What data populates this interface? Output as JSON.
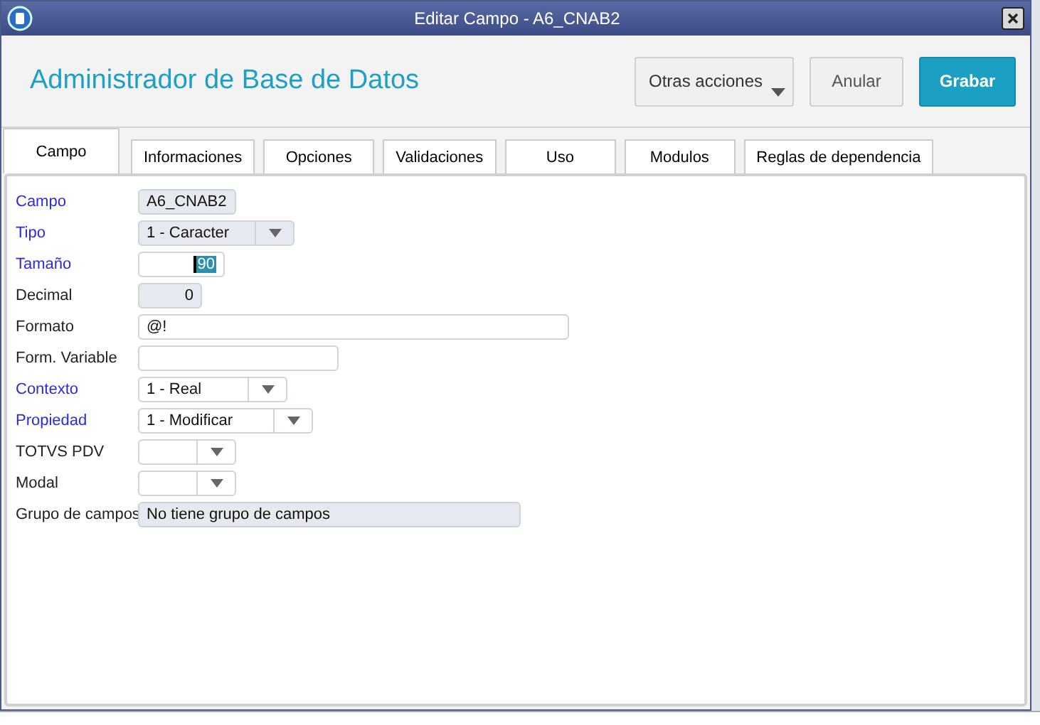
{
  "window": {
    "title": "Editar Campo - A6_CNAB2"
  },
  "header": {
    "title": "Administrador de Base de Datos",
    "buttons": [
      {
        "label": "Otras acciones",
        "kind": "menu"
      },
      {
        "label": "Anular",
        "kind": "plain"
      },
      {
        "label": "Grabar",
        "kind": "primary"
      }
    ]
  },
  "tabs": [
    {
      "label": "Campo",
      "selected": true
    },
    {
      "label": "Informaciones",
      "selected": false
    },
    {
      "label": "Opciones",
      "selected": false
    },
    {
      "label": "Validaciones",
      "selected": false
    },
    {
      "label": "Uso",
      "selected": false
    },
    {
      "label": "Modulos",
      "selected": false
    },
    {
      "label": "Reglas de dependencia",
      "selected": false
    }
  ],
  "fields": [
    {
      "label": "Campo",
      "required": true,
      "kind": "text",
      "readonly": true,
      "value": "A6_CNAB2"
    },
    {
      "label": "Tipo",
      "required": true,
      "kind": "combo",
      "readonly": true,
      "value": "1 - Caracter"
    },
    {
      "label": "Tamaño",
      "required": true,
      "kind": "number",
      "readonly": false,
      "focused": true,
      "value": "90"
    },
    {
      "label": "Decimal",
      "required": false,
      "kind": "number",
      "readonly": true,
      "focused": false,
      "value": "0"
    },
    {
      "label": "Formato",
      "required": false,
      "kind": "text",
      "readonly": false,
      "value": "@!"
    },
    {
      "label": "Form. Variable",
      "required": false,
      "kind": "text",
      "readonly": false
    },
    {
      "label": "Contexto",
      "required": true,
      "kind": "combo",
      "readonly": false,
      "value": "1 - Real"
    },
    {
      "label": "Propiedad",
      "required": true,
      "kind": "combo",
      "readonly": false,
      "value": "1 - Modificar"
    },
    {
      "label": "TOTVS PDV",
      "required": false,
      "kind": "combo",
      "readonly": false
    },
    {
      "label": "Modal",
      "required": false,
      "kind": "combo",
      "readonly": false
    },
    {
      "label": "Grupo de campos",
      "required": false,
      "kind": "text",
      "readonly": true,
      "value": "No tiene grupo de campos"
    }
  ]
}
